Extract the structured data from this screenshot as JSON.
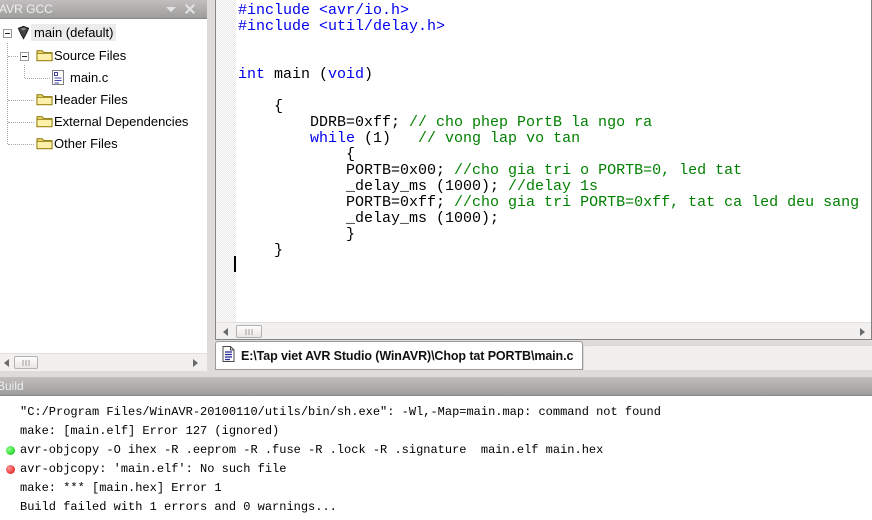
{
  "project_panel": {
    "title": "AVR GCC",
    "icons": {
      "dropdown": "dropdown-arrow-icon",
      "close": "close-icon"
    },
    "tree_items": [
      {
        "label": "main (default)",
        "depth": 0,
        "icon": "project-icon",
        "expander": "minus",
        "selected": true
      },
      {
        "label": "Source Files",
        "depth": 1,
        "icon": "folder-icon",
        "expander": "minus",
        "selected": false
      },
      {
        "label": "main.c",
        "depth": 2,
        "icon": "file-icon",
        "expander": "none",
        "selected": false
      },
      {
        "label": "Header Files",
        "depth": 1,
        "icon": "folder-icon",
        "expander": "none",
        "selected": false
      },
      {
        "label": "External Dependencies",
        "depth": 1,
        "icon": "folder-icon",
        "expander": "none",
        "selected": false
      },
      {
        "label": "Other Files",
        "depth": 1,
        "icon": "folder-icon",
        "expander": "none",
        "selected": false
      }
    ]
  },
  "editor": {
    "tab_label": "E:\\Tap viet AVR Studio (WinAVR)\\Chop tat PORTB\\main.c",
    "tab_icon": "document-icon",
    "code_lines": [
      [
        [
          "#include <avr/io.h>",
          "kw"
        ]
      ],
      [
        [
          "#include <util/delay.h>",
          "kw"
        ]
      ],
      [],
      [],
      [
        [
          "int",
          "kw"
        ],
        [
          " main (",
          "plain"
        ],
        [
          "void",
          "kw"
        ],
        [
          ")",
          "plain"
        ]
      ],
      [],
      [
        [
          "    {",
          "plain"
        ]
      ],
      [
        [
          "        DDRB=0xff; ",
          "plain"
        ],
        [
          "// cho phep PortB la ngo ra",
          "comment"
        ]
      ],
      [
        [
          "        ",
          "plain"
        ],
        [
          "while",
          "kw"
        ],
        [
          " (1)   ",
          "plain"
        ],
        [
          "// vong lap vo tan",
          "comment"
        ]
      ],
      [
        [
          "            {",
          "plain"
        ]
      ],
      [
        [
          "            PORTB=0x00; ",
          "plain"
        ],
        [
          "//cho gia tri o PORTB=0, led tat",
          "comment"
        ]
      ],
      [
        [
          "            _delay_ms (1000); ",
          "plain"
        ],
        [
          "//delay 1s",
          "comment"
        ]
      ],
      [
        [
          "            PORTB=0xff; ",
          "plain"
        ],
        [
          "//cho gia tri PORTB=0xff, tat ca led deu sang",
          "comment"
        ]
      ],
      [
        [
          "            _delay_ms (1000);",
          "plain"
        ]
      ],
      [
        [
          "            }",
          "plain"
        ]
      ],
      [
        [
          "    }",
          "plain"
        ]
      ]
    ]
  },
  "build_panel": {
    "title": "Build",
    "lines": [
      {
        "bullet": "none",
        "text": "\"C:/Program Files/WinAVR-20100110/utils/bin/sh.exe\": -Wl,-Map=main.map: command not found"
      },
      {
        "bullet": "none",
        "text": "make: [main.elf] Error 127 (ignored)"
      },
      {
        "bullet": "green",
        "text": "avr-objcopy -O ihex -R .eeprom -R .fuse -R .lock -R .signature  main.elf main.hex"
      },
      {
        "bullet": "red",
        "text": "avr-objcopy: 'main.elf': No such file"
      },
      {
        "bullet": "none",
        "text": "make: *** [main.hex] Error 1"
      },
      {
        "bullet": "none",
        "text": "Build failed with 1 errors and 0 warnings..."
      }
    ]
  },
  "colors": {
    "keyword": "#0000ee",
    "comment": "#008000",
    "code_text": "#000000",
    "bullet_green": "#00c400",
    "bullet_red": "#dd0000"
  }
}
